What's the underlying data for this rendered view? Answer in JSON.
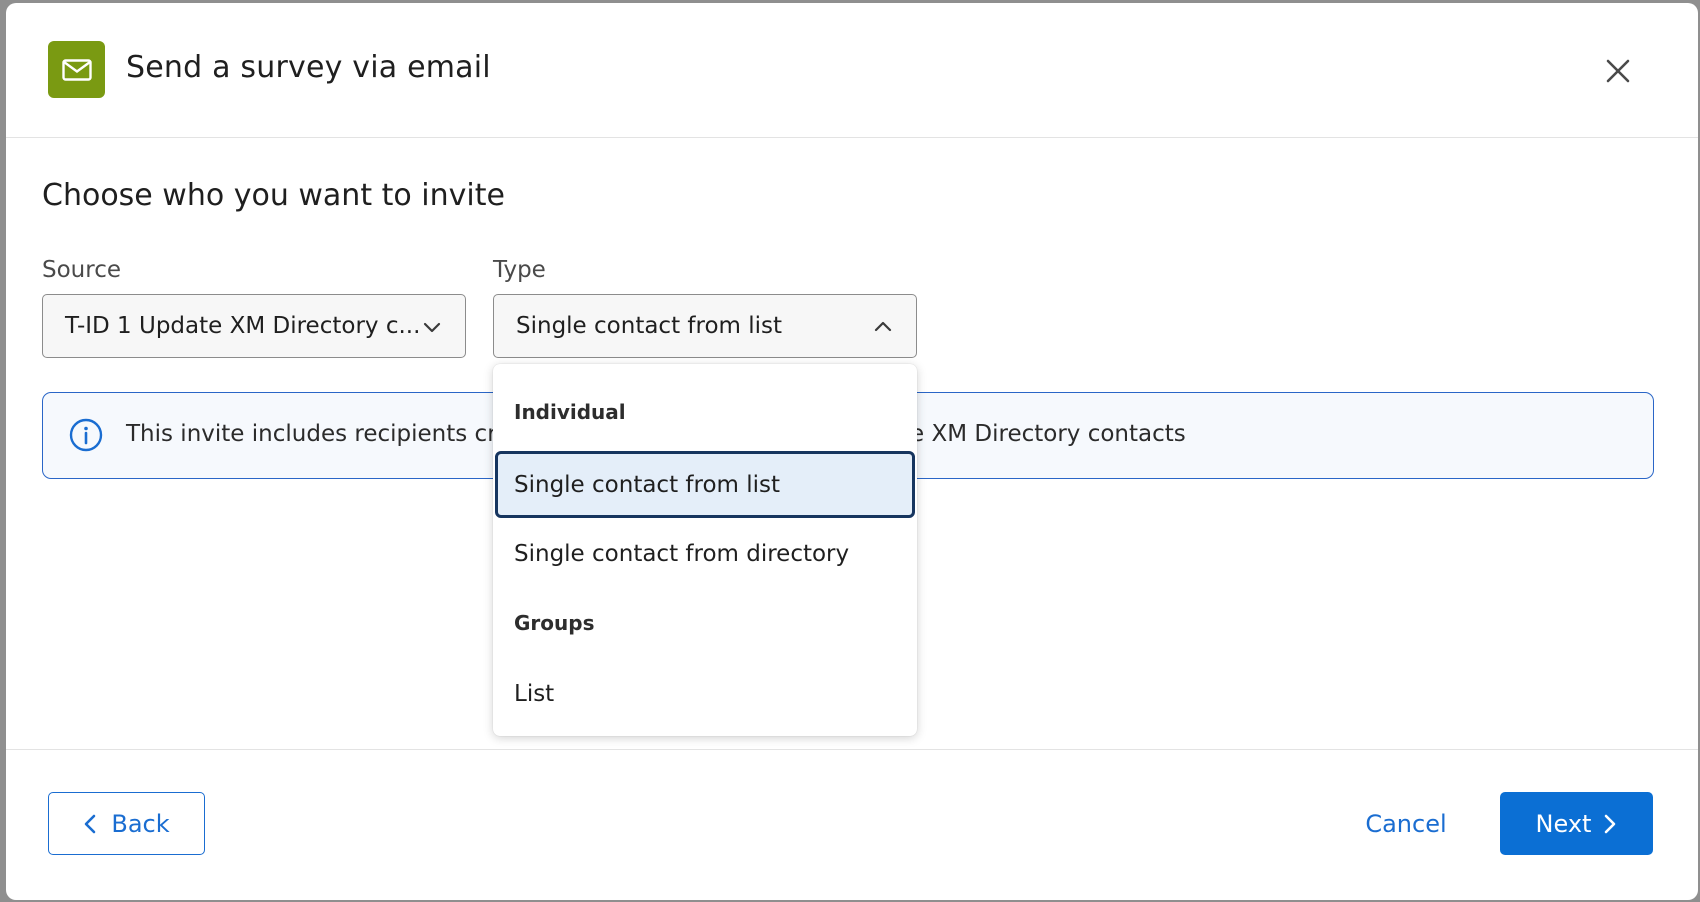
{
  "dialog": {
    "title": "Send a survey via email",
    "icon": "mail-icon",
    "accent_color": "#7a9a12"
  },
  "form": {
    "heading": "Choose who you want to invite",
    "source": {
      "label": "Source",
      "value": "T-ID 1 Update XM Directory c..."
    },
    "type": {
      "label": "Type",
      "value": "Single contact from list",
      "expanded": true
    }
  },
  "banner": {
    "text_left": "This invite includes recipients crea",
    "text_right": "te XM Directory contacts"
  },
  "dropdown": {
    "groups": [
      {
        "label": "Individual",
        "options": [
          "Single contact from list",
          "Single contact from directory"
        ]
      },
      {
        "label": "Groups",
        "options": [
          "List"
        ]
      }
    ],
    "selected": "Single contact from list"
  },
  "footer": {
    "back_label": "Back",
    "cancel_label": "Cancel",
    "next_label": "Next",
    "primary_color": "#0b6fd4"
  }
}
